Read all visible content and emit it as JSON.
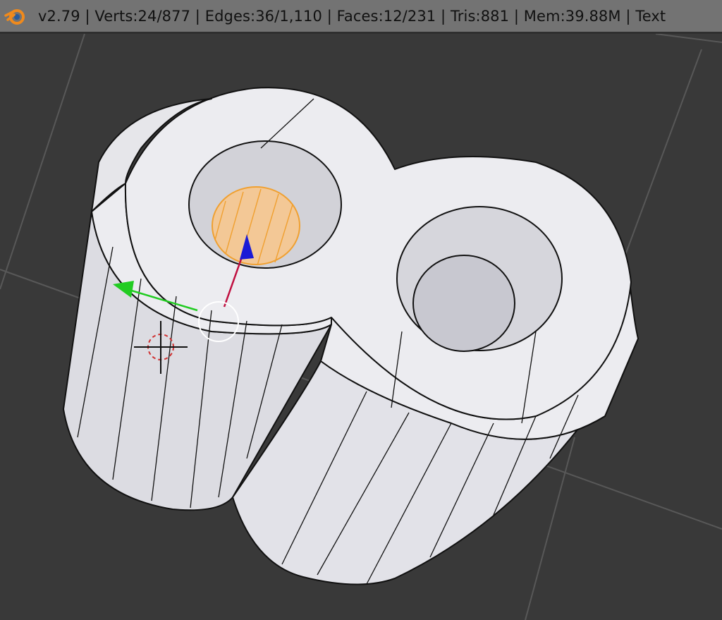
{
  "app": {
    "logo_icon": "blender-logo-icon",
    "stats_text": "v2.79 | Verts:24/877 | Edges:36/1,110 | Faces:12/231 | Tris:881 | Mem:39.88M | Text"
  },
  "viewport": {
    "background": "#393939",
    "grid_color": "#555555",
    "mesh_color": "#e8e8ec",
    "selection_color": "#f0a030",
    "gizmo": {
      "x_axis_color": "#c01040",
      "y_axis_color": "#22cc22",
      "z_axis_color": "#1a1ad6"
    }
  }
}
